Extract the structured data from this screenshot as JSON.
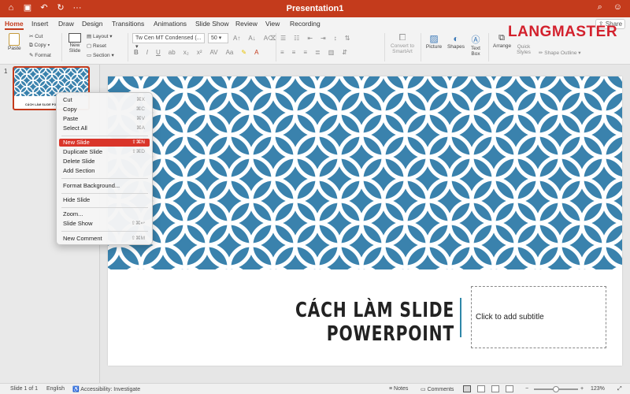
{
  "titlebar": {
    "doc_title": "Presentation1",
    "left_icons": [
      "home-icon",
      "save-icon",
      "undo-icon",
      "redo-icon",
      "more-icon"
    ],
    "right_icons": [
      "search-icon",
      "smiley-icon"
    ]
  },
  "tabs": [
    "Home",
    "Insert",
    "Draw",
    "Design",
    "Transitions",
    "Animations",
    "Slide Show",
    "Review",
    "View",
    "Recording"
  ],
  "active_tab": "Home",
  "share_label": "Share",
  "ribbon": {
    "paste": "Paste",
    "cut": "Cut",
    "copy": "Copy",
    "format": "Format",
    "new_slide_line1": "New",
    "new_slide_line2": "Slide",
    "layout": "Layout",
    "reset": "Reset",
    "section": "Section",
    "font_name": "Tw Cen MT Condensed (...",
    "font_size": "50",
    "convert_line1": "Convert to",
    "convert_line2": "SmartArt",
    "picture": "Picture",
    "shapes": "Shapes",
    "text_box_line1": "Text",
    "text_box_line2": "Box",
    "arrange": "Arrange",
    "quick_styles_line1": "Quick",
    "quick_styles_line2": "Styles",
    "shape_outline": "Shape Outline"
  },
  "logo": {
    "text": "LANGMASTER"
  },
  "thumbnail": {
    "number": "1",
    "title": "CÁCH LÀM SLIDE POWERPOINT"
  },
  "slide": {
    "title": "CÁCH LÀM SLIDE POWERPOINT",
    "subtitle_placeholder": "Click to add subtitle",
    "pattern_color": "#3a82ad"
  },
  "context_menu": {
    "items": [
      {
        "label": "Cut",
        "shortcut": "⌘X"
      },
      {
        "label": "Copy",
        "shortcut": "⌘C"
      },
      {
        "label": "Paste",
        "shortcut": "⌘V"
      },
      {
        "label": "Select All",
        "shortcut": "⌘A"
      },
      {
        "label": "New Slide",
        "shortcut": "⇧⌘N",
        "highlighted": true
      },
      {
        "label": "Duplicate Slide",
        "shortcut": "⇧⌘D"
      },
      {
        "label": "Delete Slide",
        "shortcut": ""
      },
      {
        "label": "Add Section",
        "shortcut": ""
      },
      {
        "label": "Format Background...",
        "shortcut": ""
      },
      {
        "label": "Hide Slide",
        "shortcut": ""
      },
      {
        "label": "Zoom...",
        "shortcut": ""
      },
      {
        "label": "Slide Show",
        "shortcut": "⇧⌘↩"
      },
      {
        "label": "New Comment",
        "shortcut": "⇧⌘M"
      }
    ]
  },
  "statusbar": {
    "slide_info": "Slide 1 of 1",
    "language": "English",
    "accessibility": "Accessibility: Investigate",
    "notes": "Notes",
    "comments": "Comments",
    "zoom_minus": "−",
    "zoom_plus": "+",
    "zoom_level": "123%",
    "zoom_fraction": 0.5
  },
  "colors": {
    "accent": "#c43b1c",
    "menu_highlight": "#d9352a",
    "title_rule": "#2f87a8"
  }
}
